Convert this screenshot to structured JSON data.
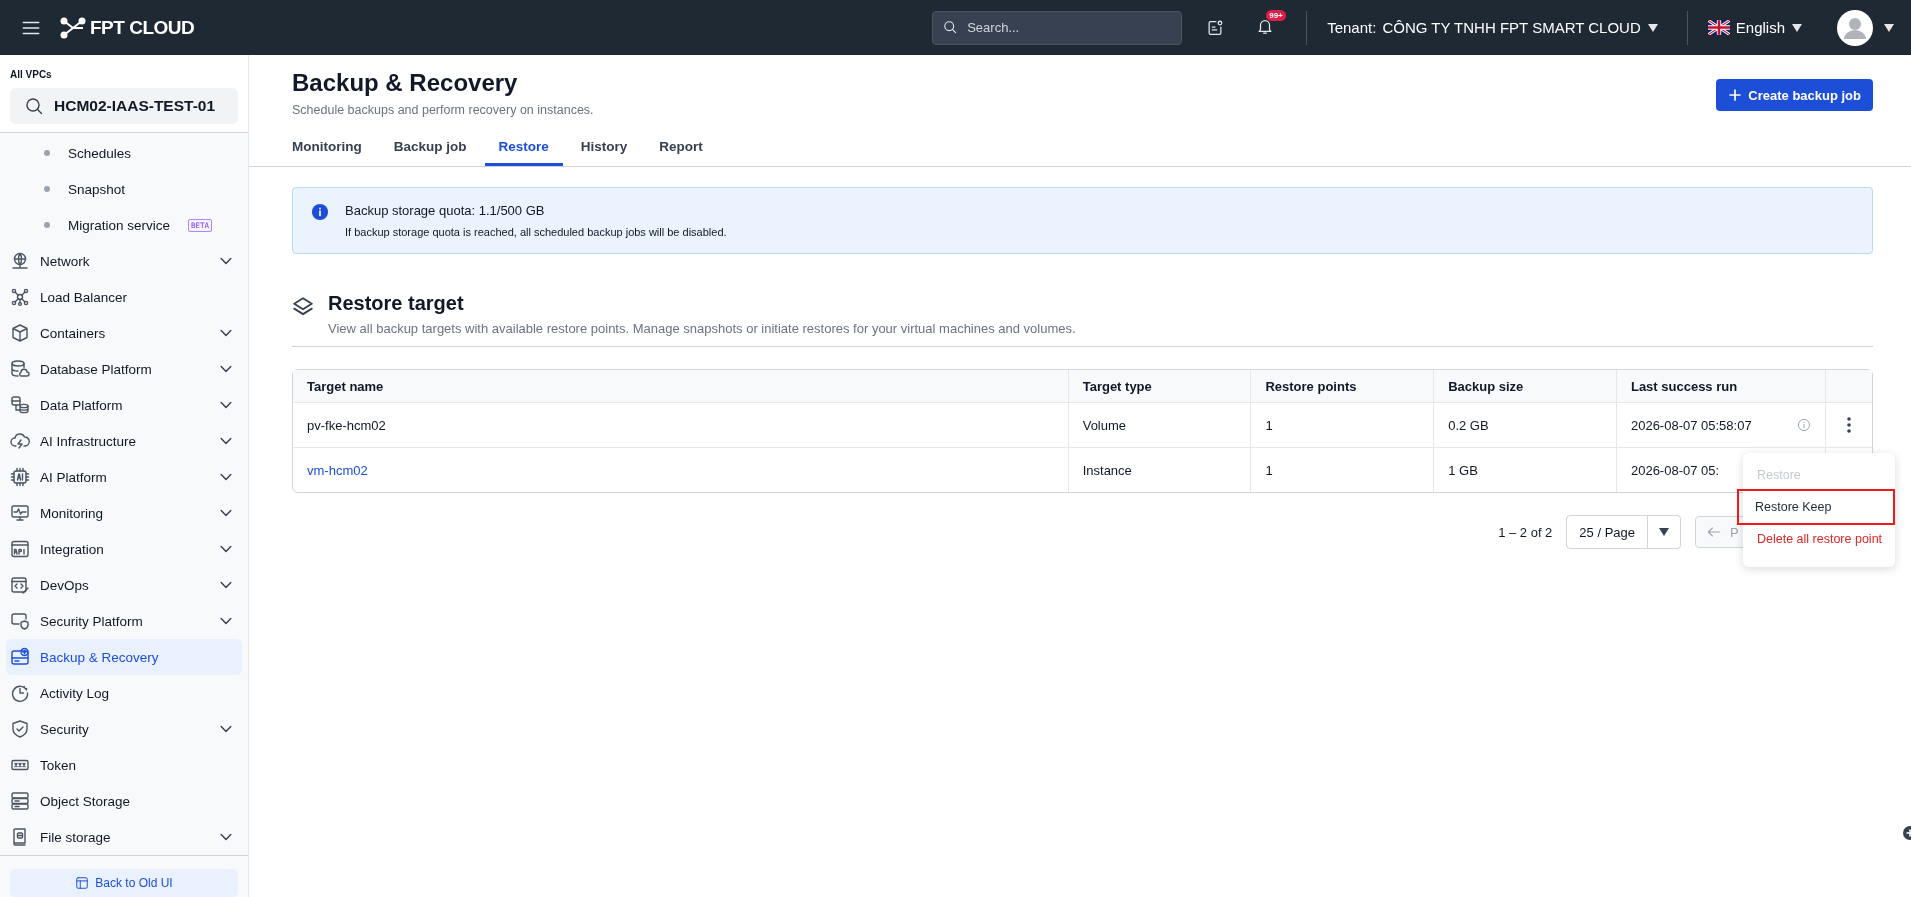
{
  "topbar": {
    "logo": "FPT CLOUD",
    "search": {
      "placeholder": "Search..."
    },
    "notifications_badge": "99+",
    "tenant_label": "Tenant:",
    "tenant": "CÔNG TY TNHH FPT SMART CLOUD",
    "language": "English"
  },
  "sidebar": {
    "vpc_label": "All VPCs",
    "vpc": "HCM02-IAAS-TEST-01",
    "items": [
      {
        "kind": "sub",
        "label": "Schedules",
        "selected": false
      },
      {
        "kind": "sub",
        "label": "Snapshot",
        "selected": false
      },
      {
        "kind": "sub",
        "label": "Migration service",
        "badge": "BETA",
        "selected": false
      },
      {
        "kind": "main",
        "label": "Network",
        "expandable": true,
        "selected": false
      },
      {
        "kind": "main",
        "label": "Load Balancer",
        "expandable": false,
        "selected": false
      },
      {
        "kind": "main",
        "label": "Containers",
        "expandable": true,
        "selected": false
      },
      {
        "kind": "main",
        "label": "Database Platform",
        "expandable": true,
        "selected": false
      },
      {
        "kind": "main",
        "label": "Data Platform",
        "expandable": true,
        "selected": false
      },
      {
        "kind": "main",
        "label": "AI Infrastructure",
        "expandable": true,
        "selected": false
      },
      {
        "kind": "main",
        "label": "AI Platform",
        "expandable": true,
        "selected": false
      },
      {
        "kind": "main",
        "label": "Monitoring",
        "expandable": true,
        "selected": false
      },
      {
        "kind": "main",
        "label": "Integration",
        "expandable": true,
        "selected": false
      },
      {
        "kind": "main",
        "label": "DevOps",
        "expandable": true,
        "selected": false
      },
      {
        "kind": "main",
        "label": "Security Platform",
        "expandable": true,
        "selected": false
      },
      {
        "kind": "main",
        "label": "Backup & Recovery",
        "expandable": false,
        "selected": true
      },
      {
        "kind": "main",
        "label": "Activity Log",
        "expandable": false,
        "selected": false
      },
      {
        "kind": "main",
        "label": "Security",
        "expandable": true,
        "selected": false
      },
      {
        "kind": "main",
        "label": "Token",
        "expandable": false,
        "selected": false
      },
      {
        "kind": "main",
        "label": "Object Storage",
        "expandable": false,
        "selected": false
      },
      {
        "kind": "main",
        "label": "File storage",
        "expandable": true,
        "selected": false
      }
    ],
    "footer_button": "Back to Old UI"
  },
  "page": {
    "title": "Backup & Recovery",
    "subtitle": "Schedule backups and perform recovery on instances.",
    "create_button": "Create backup job"
  },
  "tabs": [
    {
      "label": "Monitoring",
      "selected": false
    },
    {
      "label": "Backup job",
      "selected": false
    },
    {
      "label": "Restore",
      "selected": true
    },
    {
      "label": "History",
      "selected": false
    },
    {
      "label": "Report",
      "selected": false
    }
  ],
  "alert": {
    "title": "Backup storage quota: 1.1/500 GB",
    "message": "If backup storage quota is reached, all scheduled backup jobs will be disabled."
  },
  "section": {
    "title": "Restore target",
    "description": "View all backup targets with available restore points. Manage snapshots or initiate restores for your virtual machines and volumes."
  },
  "table": {
    "columns": [
      "Target name",
      "Target type",
      "Restore points",
      "Backup size",
      "Last success run"
    ],
    "rows": [
      {
        "cells": [
          "pv-fke-hcm02",
          "Volume",
          "1",
          "0.2 GB",
          "2026-08-07 05:58:07"
        ],
        "link": false,
        "info_icon": true,
        "more_button": true
      },
      {
        "cells": [
          "vm-hcm02",
          "Instance",
          "1",
          "1 GB",
          "2026-08-07 05:"
        ],
        "link": true,
        "info_icon": false,
        "more_button": false
      }
    ]
  },
  "pagination": {
    "range": "1 – 2 of 2",
    "page_size": "25 / Page",
    "prev": "P"
  },
  "menu": {
    "items": [
      {
        "label": "Restore",
        "disabled": true,
        "danger": false,
        "highlighted": false
      },
      {
        "label": "Restore Keep",
        "disabled": false,
        "danger": false,
        "highlighted": true
      },
      {
        "label": "Delete all restore point",
        "disabled": false,
        "danger": true,
        "highlighted": false
      }
    ]
  }
}
